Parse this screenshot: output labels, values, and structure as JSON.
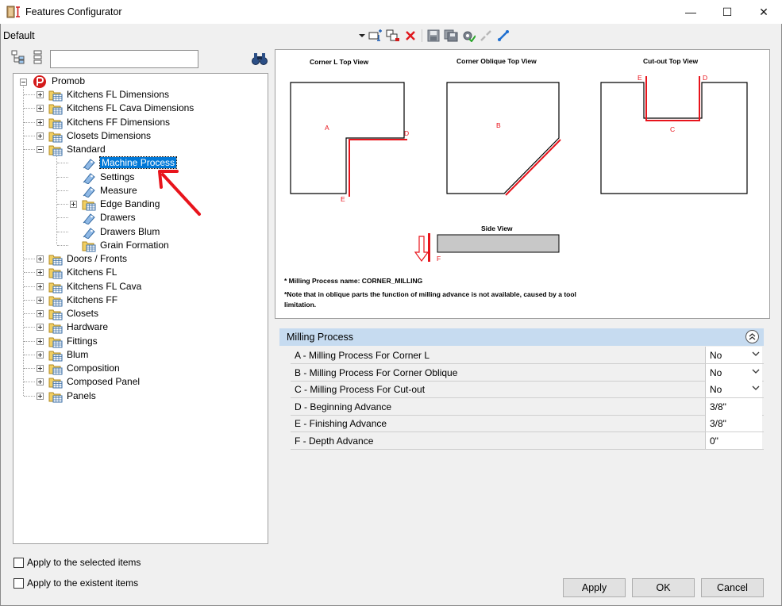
{
  "window": {
    "title": "Features Configurator",
    "minimize_glyph": "—",
    "maximize_glyph": "☐",
    "close_glyph": "✕"
  },
  "profile": {
    "name": "Default"
  },
  "toolbar": {
    "icons": [
      "dropdown-arrow-icon",
      "add-feature-icon",
      "copy-feature-icon",
      "delete-icon",
      "save-icon",
      "save-all-icon",
      "settings-gear-icon",
      "disconnect-icon",
      "connect-icon"
    ]
  },
  "search": {
    "value": ""
  },
  "tree": {
    "root": "Promob",
    "items": [
      "Kitchens FL Dimensions",
      "Kitchens FL Cava Dimensions",
      "Kitchens FF Dimensions",
      "Closets Dimensions",
      "Standard",
      "Machine Process",
      "Settings",
      "Measure",
      "Edge Banding",
      "Drawers",
      "Drawers Blum",
      "Grain Formation",
      "Doors / Fronts",
      "Kitchens FL",
      "Kitchens FL Cava",
      "Kitchens FF",
      "Closets",
      "Hardware",
      "Fittings",
      "Blum",
      "Composition",
      "Composed Panel",
      "Panels"
    ],
    "selected": "Machine Process"
  },
  "options": {
    "apply_selected": "Apply to the selected items",
    "apply_existent": "Apply to the existent items"
  },
  "preview": {
    "corner_l_title": "Corner L Top View",
    "corner_oblique_title": "Corner Oblique Top View",
    "cutout_title": "Cut-out Top View",
    "side_view_title": "Side View",
    "label_a": "A",
    "label_b": "B",
    "label_c": "C",
    "label_d": "D",
    "label_e": "E",
    "label_f": "F",
    "note1": "* Milling Process name: CORNER_MILLING",
    "note2": "*Note that in oblique parts the function of milling advance is not available, caused by a tool",
    "note3": "limitation.",
    "accent": "#e8141c"
  },
  "properties": {
    "section_title": "Milling Process",
    "rows": [
      {
        "name": "A -  Milling Process For Corner L",
        "value": "No",
        "dropdown": true
      },
      {
        "name": "B -  Milling Process For Corner Oblique",
        "value": "No",
        "dropdown": true
      },
      {
        "name": "C -  Milling Process For Cut-out",
        "value": "No",
        "dropdown": true
      },
      {
        "name": "D -  Beginning Advance",
        "value": "3/8\"",
        "dropdown": false
      },
      {
        "name": "E -  Finishing Advance",
        "value": "3/8\"",
        "dropdown": false
      },
      {
        "name": "F -  Depth Advance",
        "value": "0\"",
        "dropdown": false
      }
    ]
  },
  "buttons": {
    "apply": "Apply",
    "ok": "OK",
    "cancel": "Cancel"
  }
}
